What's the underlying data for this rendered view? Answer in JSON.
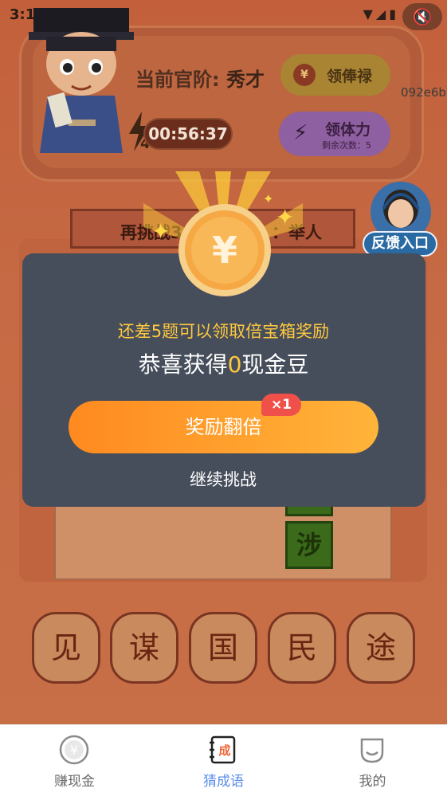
{
  "status_bar": {
    "time": "3:1",
    "icons": "▼◢▮"
  },
  "header": {
    "rank_prefix": "当前官阶:",
    "rank_value": "秀才",
    "salary_button": "领俸禄",
    "id_text": "092e6b",
    "timer": "00:56:37",
    "energy_count": "4",
    "energy_button": "领体力",
    "energy_remaining": "剩余次数：5"
  },
  "challenge": {
    "prefix": "再挑战3",
    "suffix": "：举人"
  },
  "feedback": {
    "label": "反馈入口"
  },
  "board": {
    "green_tile": "涉"
  },
  "choices": [
    "见",
    "谋",
    "国",
    "民",
    "途"
  ],
  "modal": {
    "coin_symbol": "¥",
    "message_line1": "还差5题可以领取倍宝箱奖励",
    "message_line2_prefix": "恭喜获得",
    "message_line2_amount": "0",
    "message_line2_suffix": "现金豆",
    "double_button": "奖励翻倍",
    "double_badge": "×1",
    "continue_button": "继续挑战"
  },
  "bottom_nav": {
    "items": [
      {
        "label": "赚现金",
        "icon": "yen-circle-icon",
        "active": false
      },
      {
        "label": "猜成语",
        "icon": "notebook-icon",
        "icon_text": "成",
        "active": true
      },
      {
        "label": "我的",
        "icon": "cup-icon",
        "active": false
      }
    ]
  },
  "colors": {
    "accent_orange": "#ff8a1f",
    "accent_gold": "#ffc93e",
    "active_tab": "#5b8de8",
    "modal_bg": "#464d5b"
  }
}
